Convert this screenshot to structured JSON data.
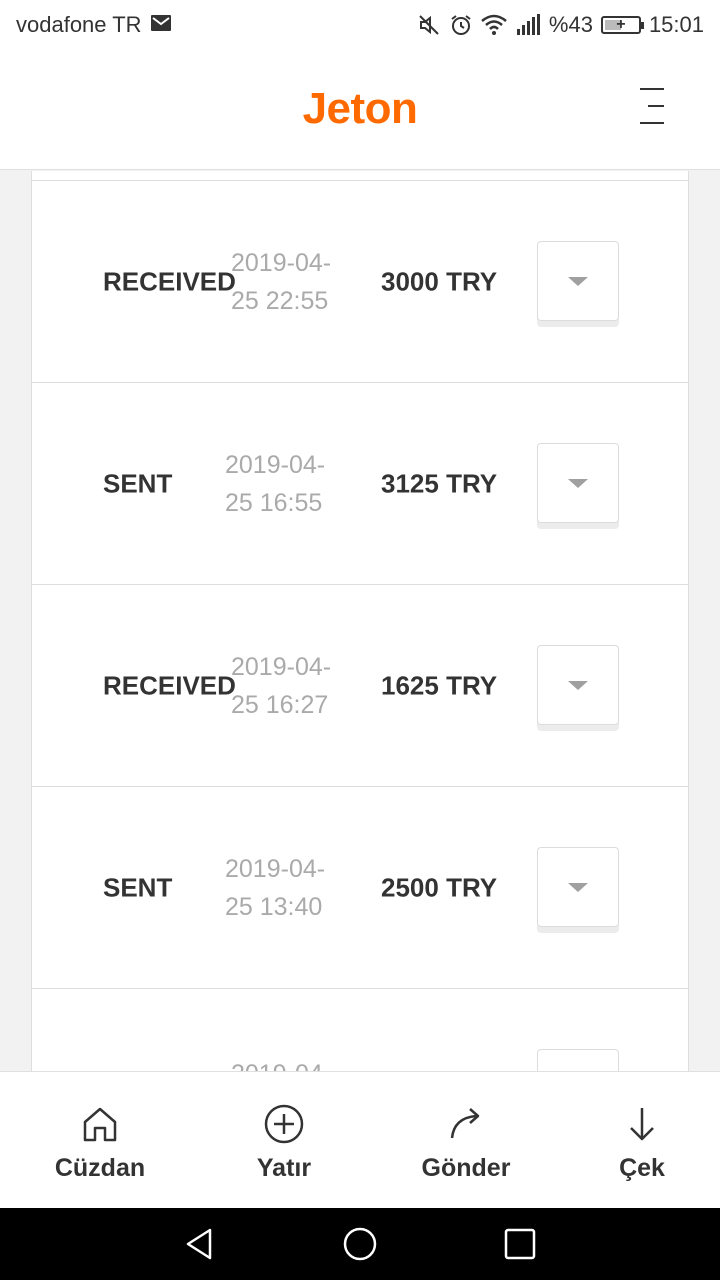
{
  "status_bar": {
    "carrier": "vodafone TR",
    "battery_percent": "%43",
    "time": "15:01",
    "icons": [
      "mail-icon",
      "mute-icon",
      "alarm-icon",
      "wifi-icon",
      "signal-icon",
      "battery-icon"
    ]
  },
  "header": {
    "logo": "Jeton",
    "brand_color": "#ff6a00",
    "menu_icon": "menu-icon"
  },
  "transactions": [
    {
      "type": "RECEIVED",
      "date": "2019-04-25 22:55",
      "date_line1": "2019-04-",
      "date_line2": "25 22:55",
      "amount": "3000 TRY"
    },
    {
      "type": "SENT",
      "date": "2019-04-25 16:55",
      "date_line1": "2019-04-",
      "date_line2": "25 16:55",
      "amount": "3125 TRY"
    },
    {
      "type": "RECEIVED",
      "date": "2019-04-25 16:27",
      "date_line1": "2019-04-",
      "date_line2": "25 16:27",
      "amount": "1625 TRY"
    },
    {
      "type": "SENT",
      "date": "2019-04-25 13:40",
      "date_line1": "2019-04-",
      "date_line2": "25 13:40",
      "amount": "2500 TRY"
    },
    {
      "type": "",
      "date": "2019-04",
      "date_line1": "2019-04",
      "date_line2": "",
      "amount": ""
    }
  ],
  "bottom_nav": {
    "items": [
      {
        "label": "Cüzdan",
        "icon": "home-icon"
      },
      {
        "label": "Yatır",
        "icon": "plus-circle-icon"
      },
      {
        "label": "Gönder",
        "icon": "send-arrow-icon"
      },
      {
        "label": "Çek",
        "icon": "arrow-down-icon"
      }
    ]
  },
  "system_nav": {
    "icons": [
      "back-icon",
      "home-circle-icon",
      "recents-icon"
    ]
  }
}
